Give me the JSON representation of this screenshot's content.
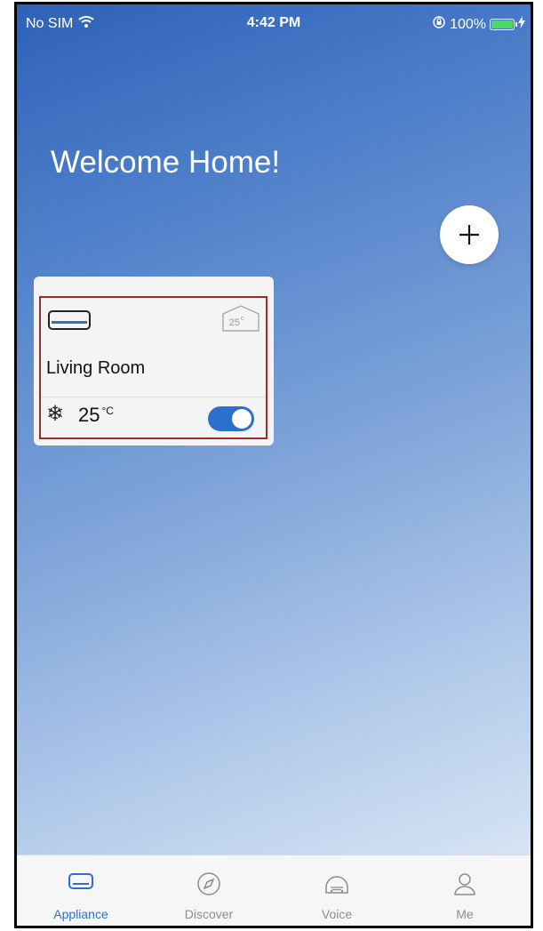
{
  "status_bar": {
    "carrier": "No SIM",
    "time": "4:42 PM",
    "battery_percent": "100%",
    "battery_level": 1.0
  },
  "header": {
    "title": "Welcome Home!"
  },
  "add_button": {
    "icon": "plus-icon"
  },
  "devices": [
    {
      "name": "Living Room",
      "mode_icon": "snowflake-icon",
      "mode_glyph": "❄",
      "set_temp": "25",
      "set_temp_unit": "c",
      "current_temp": "25",
      "current_temp_unit": "°C",
      "power_on": true,
      "selected_outline_color": "#9e2a2a"
    }
  ],
  "tabbar": {
    "active_color": "#2c6fcf",
    "items": [
      {
        "label": "Appliance",
        "icon": "appliance-icon",
        "active": true
      },
      {
        "label": "Discover",
        "icon": "compass-icon",
        "active": false
      },
      {
        "label": "Voice",
        "icon": "voice-icon",
        "active": false
      },
      {
        "label": "Me",
        "icon": "person-icon",
        "active": false
      }
    ]
  }
}
